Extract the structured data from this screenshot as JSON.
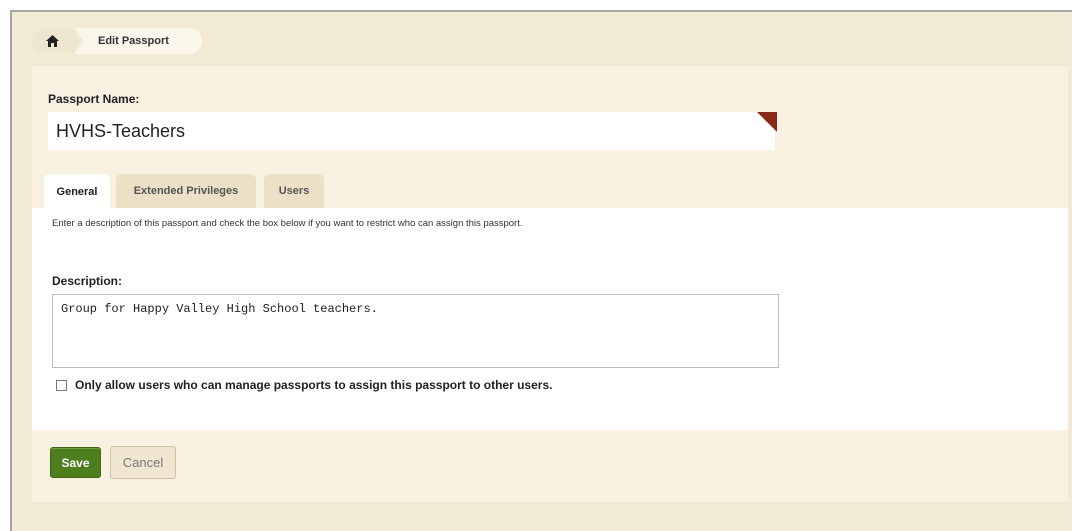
{
  "breadcrumb": {
    "home_icon": "home-icon",
    "current": "Edit Passport"
  },
  "passport": {
    "name_label": "Passport Name:",
    "name_value": "HVHS-Teachers"
  },
  "tabs": [
    {
      "label": "General",
      "active": true
    },
    {
      "label": "Extended Privileges",
      "active": false
    },
    {
      "label": "Users",
      "active": false
    }
  ],
  "general": {
    "help_text": "Enter a description of this passport and check the box below if you want to restrict who can assign this passport.",
    "description_label": "Description:",
    "description_value": "Group for Happy Valley High School teachers.",
    "restrict_label": "Only allow users who can manage passports to assign this passport to other users.",
    "restrict_checked": false
  },
  "actions": {
    "save_label": "Save",
    "cancel_label": "Cancel"
  },
  "colors": {
    "save_bg": "#4e7f1e",
    "required_flag": "#8a2a16",
    "panel_bg": "#f8f1e1"
  }
}
